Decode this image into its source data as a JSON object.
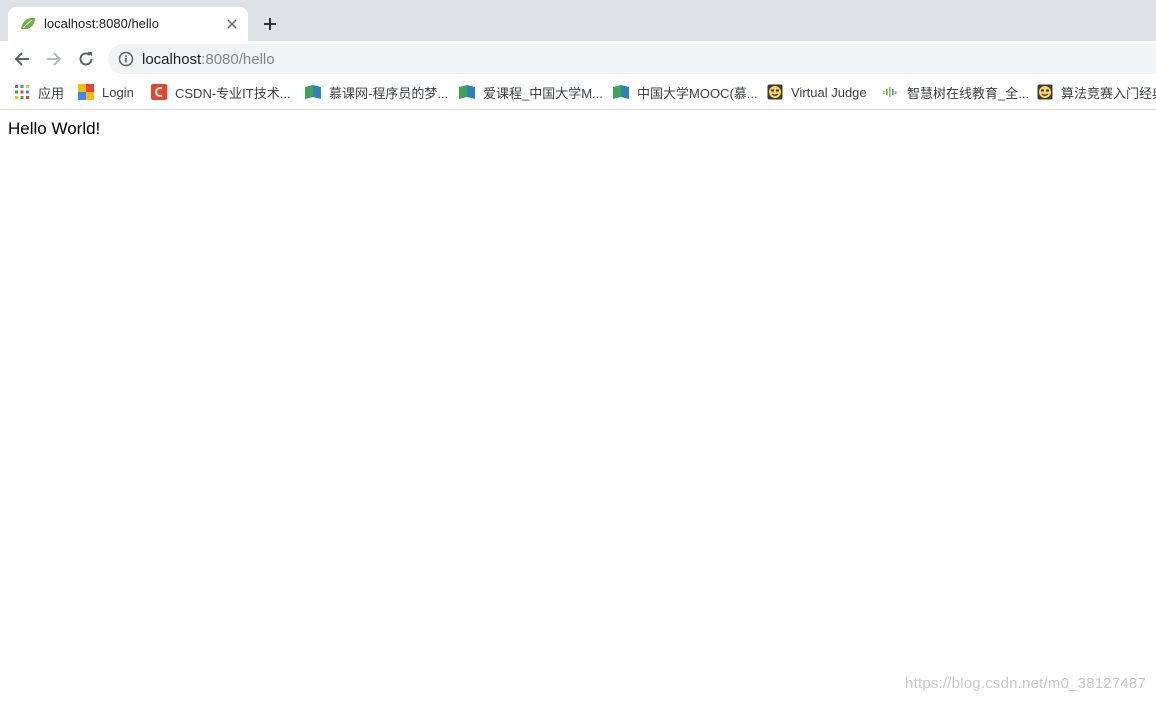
{
  "tab": {
    "title": "localhost:8080/hello",
    "favicon": "spring-leaf-icon"
  },
  "omnibox": {
    "host": "localhost",
    "path": ":8080/hello"
  },
  "bookmarks": [
    {
      "label": "应用",
      "icon": "apps-grid-icon"
    },
    {
      "label": "Login",
      "icon": "login-icon"
    },
    {
      "label": "CSDN-专业IT技术...",
      "icon": "csdn-icon"
    },
    {
      "label": "慕课网-程序员的梦...",
      "icon": "book-icon"
    },
    {
      "label": "爱课程_中国大学M...",
      "icon": "book-icon"
    },
    {
      "label": "中国大学MOOC(慕...",
      "icon": "book-icon"
    },
    {
      "label": "Virtual Judge",
      "icon": "smiley-icon"
    },
    {
      "label": "智慧树在线教育_全...",
      "icon": "wave-icon"
    },
    {
      "label": "算法竞赛入门经典",
      "icon": "smiley-icon"
    }
  ],
  "page": {
    "text": "Hello World!"
  },
  "watermark": "https://blog.csdn.net/m0_38127487",
  "colors": {
    "tabstrip": "#dee1e6",
    "omnibox": "#f1f3f4",
    "spring_green": "#6db33f",
    "csdn_red": "#e8442f"
  }
}
